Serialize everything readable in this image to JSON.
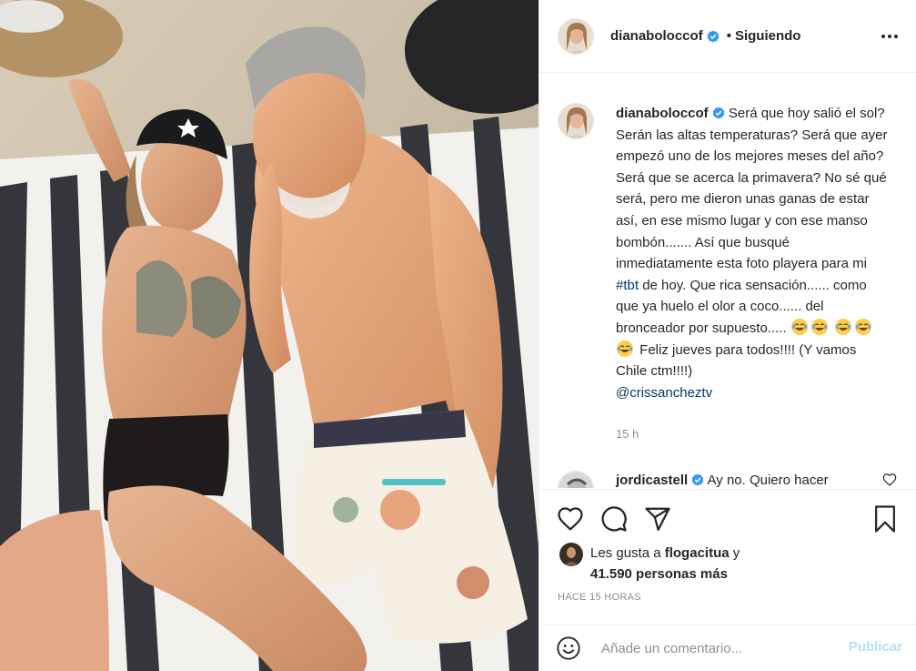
{
  "post": {
    "username": "dianaboloccof",
    "dot": "•",
    "following_label": "Siguiendo"
  },
  "caption": {
    "username": "dianaboloccof",
    "text_1": "Será que hoy salió el sol? Serán las altas temperaturas? Será que ayer empezó uno de los mejores meses del año? Será que se acerca la primavera? No sé qué será, pero me dieron unas ganas de estar así, en ese mismo lugar y con ese manso bombón....... Así que busqué inmediatamente esta foto playera para mi ",
    "hashtag": "#tbt",
    "text_2": " de hoy. Que rica sensación...... como que ya huelo el olor a coco...... del bronceador por supuesto..... ",
    "text_3": " Feliz jueves para todos!!!! (Y vamos Chile ctm!!!!)",
    "mention": "@crissancheztv",
    "time": "15 h"
  },
  "comment": {
    "username": "jordicastell",
    "text": "Ay no. Quiero hacer"
  },
  "likes": {
    "prefix": "Les gusta a ",
    "liker": "flogacitua",
    "middle": " y ",
    "count": "41.590 personas más"
  },
  "date_label": "HACE 15 HORAS",
  "composer": {
    "placeholder": "Añade un comentario...",
    "publish_label": "Publicar"
  },
  "colors": {
    "verified": "#3897f0",
    "link": "#00376b",
    "publish_disabled": "#b2dffc",
    "muted": "#8e8e8e"
  },
  "icons": {
    "verified": "verified-badge-icon",
    "more": "more-options-icon",
    "like": "heart-icon",
    "comment": "comment-bubble-icon",
    "share": "paper-plane-icon",
    "save": "bookmark-icon",
    "emoji_picker": "smiley-icon",
    "laughing": "tears-of-joy-emoji"
  }
}
